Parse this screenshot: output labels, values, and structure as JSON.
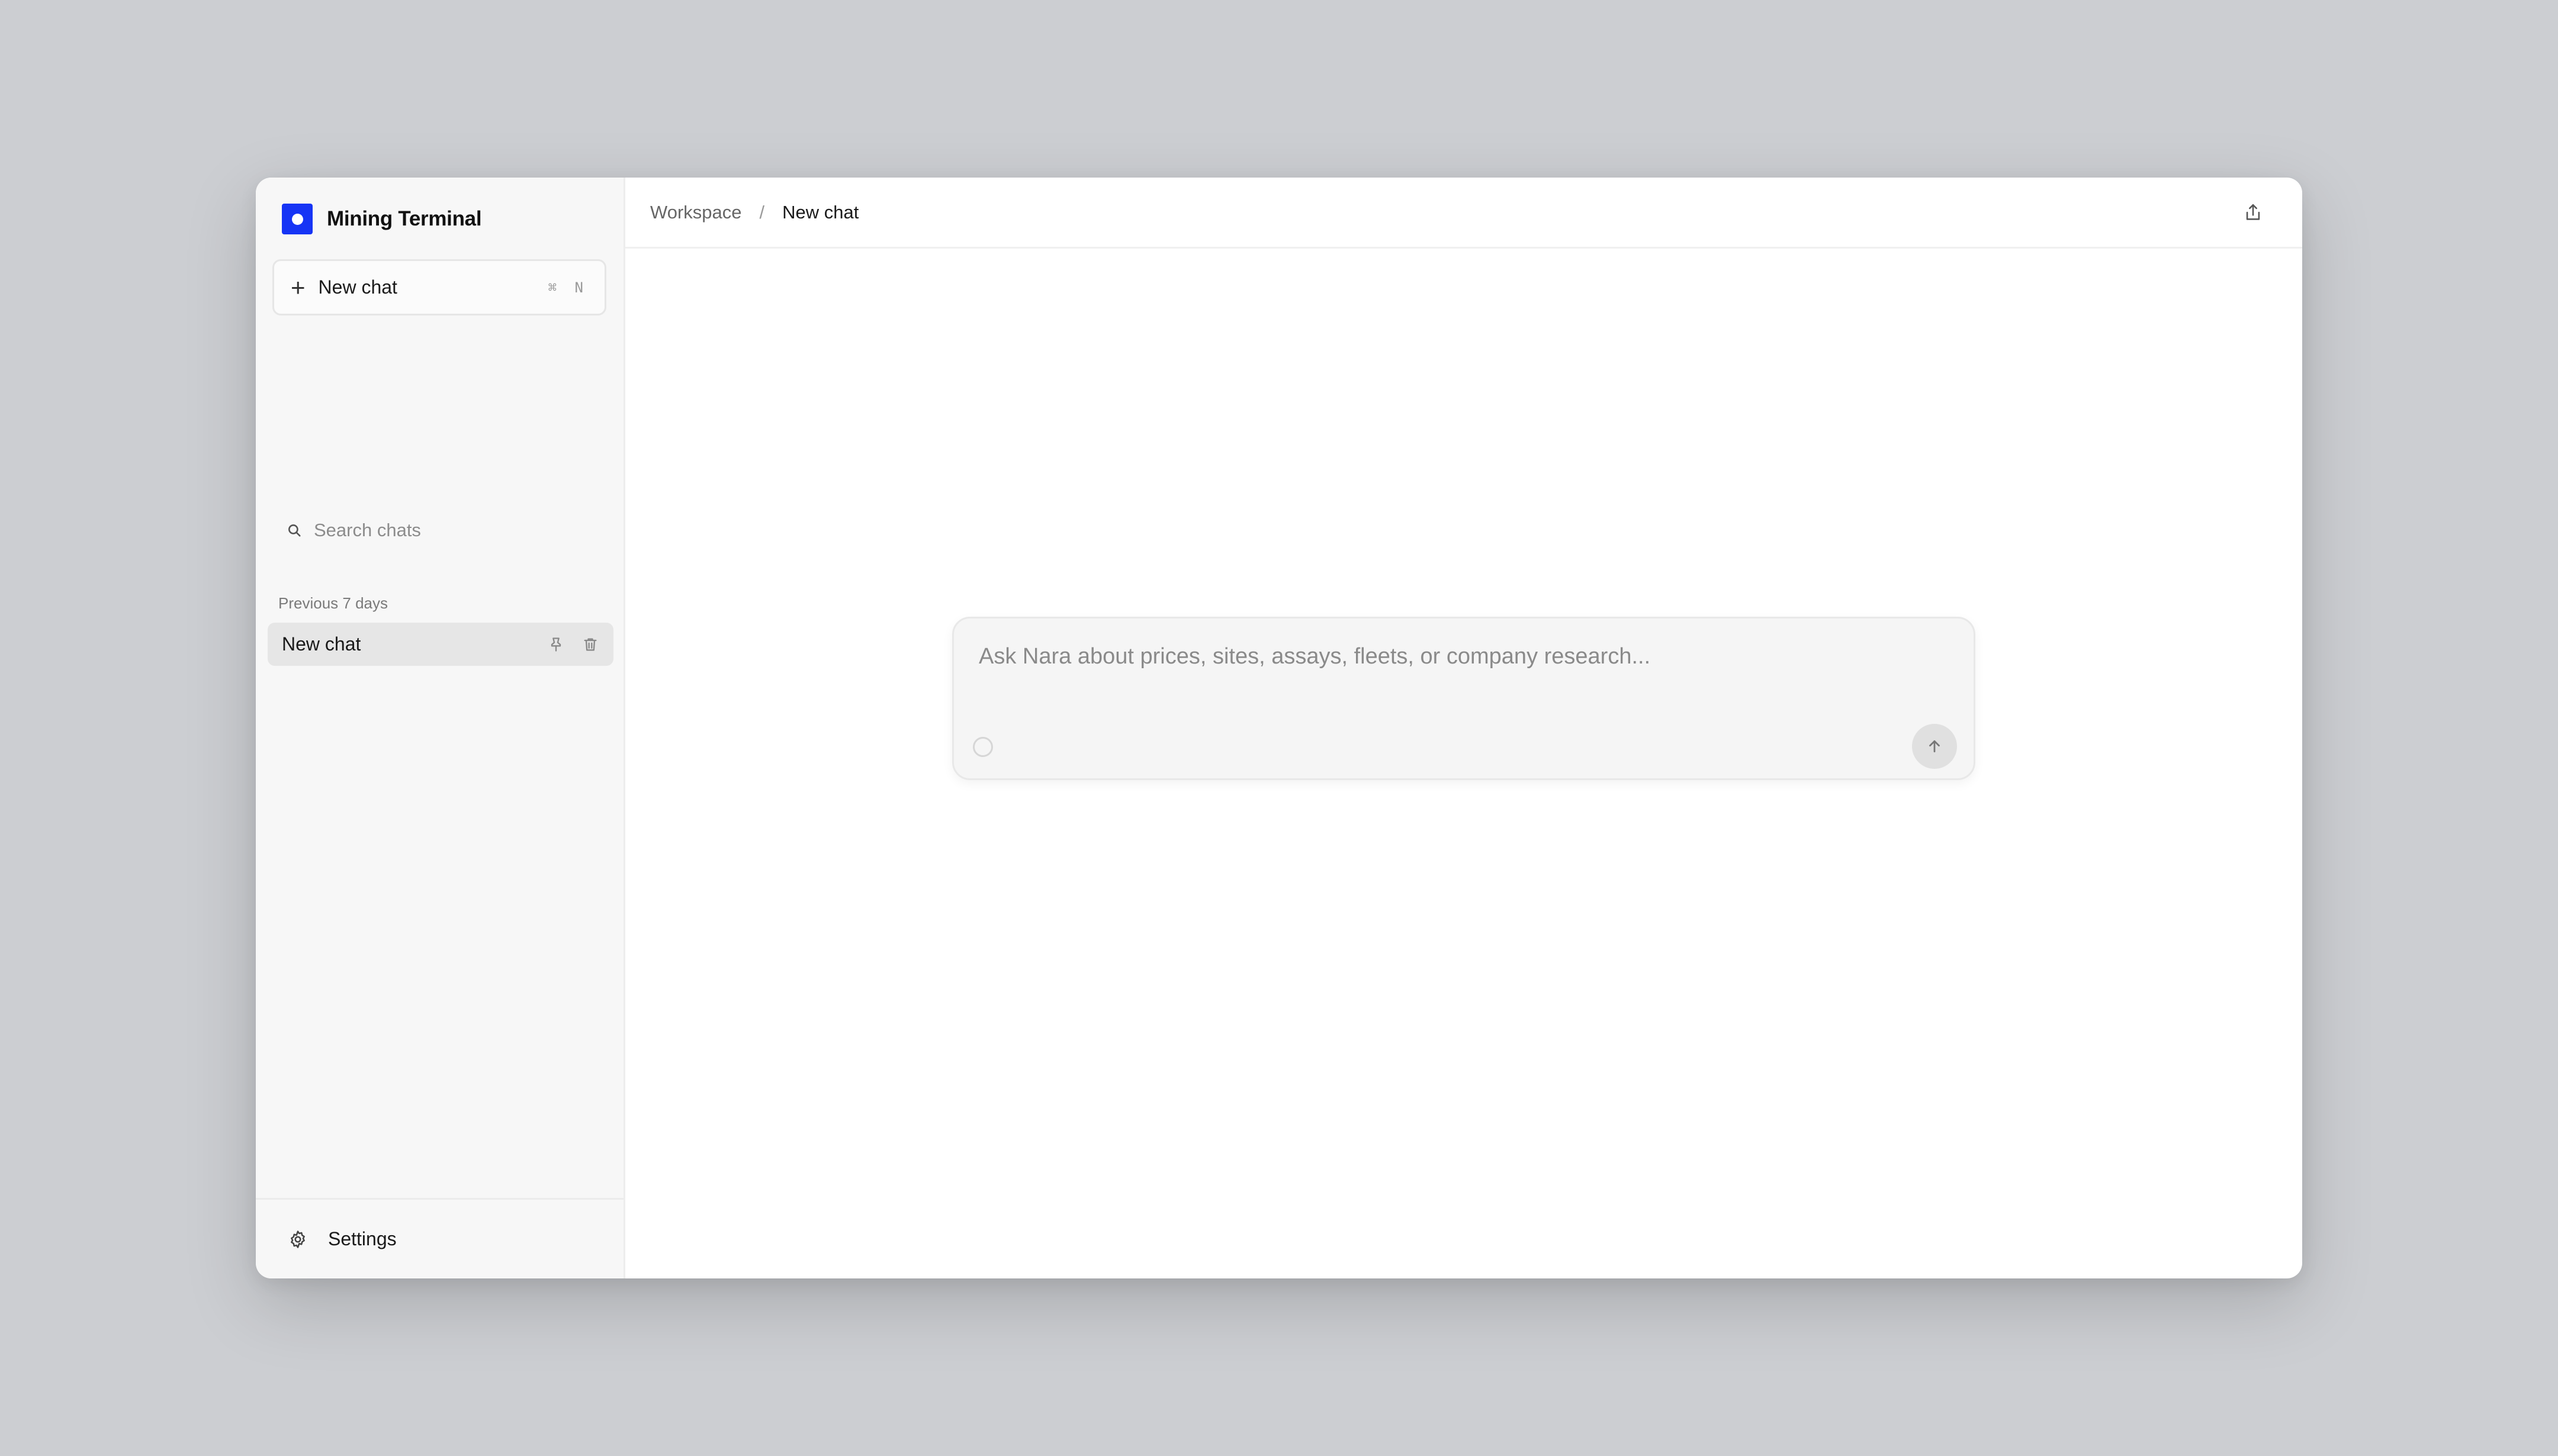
{
  "app": {
    "name": "Mining Terminal",
    "accent": "#1634f5"
  },
  "sidebar": {
    "new_chat_label": "New chat",
    "new_chat_shortcut": "⌘ N",
    "search_placeholder": "Search chats",
    "section_label": "Previous 7 days",
    "chats": [
      {
        "label": "New chat"
      }
    ],
    "settings_label": "Settings"
  },
  "header": {
    "breadcrumb_root": "Workspace",
    "breadcrumb_separator": "/",
    "breadcrumb_current": "New chat"
  },
  "composer": {
    "placeholder": "Ask Nara about prices, sites, assays, fleets, or company research...",
    "value": ""
  },
  "icons": {
    "new_chat": "plus-icon",
    "search": "search-icon",
    "pin": "pin-icon",
    "delete": "trash-icon",
    "settings": "gear-icon",
    "share": "share-icon",
    "attach": "circle-icon",
    "send": "arrow-up-icon"
  }
}
